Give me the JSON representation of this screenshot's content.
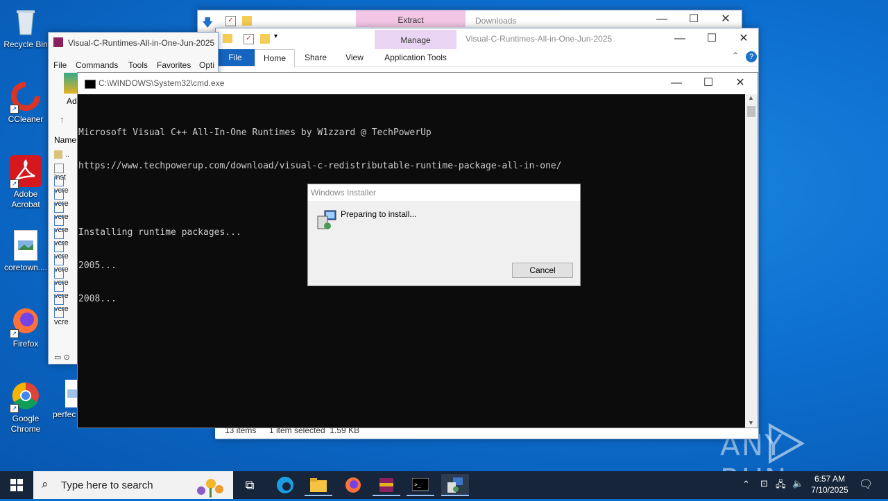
{
  "desktop": {
    "icons": [
      {
        "label": "Recycle Bin"
      },
      {
        "label": "CCleaner"
      },
      {
        "label": "Adobe Acrobat"
      },
      {
        "label": "coretown...."
      },
      {
        "label": "Firefox"
      },
      {
        "label": "Google Chrome"
      },
      {
        "label": "perfec"
      }
    ],
    "watermark": "ANY RUN"
  },
  "downloads_window": {
    "title": "Downloads",
    "context_tab": "Extract"
  },
  "explorer_window": {
    "title": "Visual-C-Runtimes-All-in-One-Jun-2025",
    "context_tab": "Manage",
    "tabs": [
      "File",
      "Home",
      "Share",
      "View",
      "Application Tools"
    ],
    "status_items": "13 items",
    "status_selected": "1 item selected  1.59 KB"
  },
  "winrar_window": {
    "title": "Visual-C-Runtimes-All-in-One-Jun-2025",
    "menu": [
      "File",
      "Commands",
      "Tools",
      "Favorites",
      "Opti"
    ],
    "toolbar_label": "Ad",
    "column_name": "Name",
    "rows": [
      "..",
      "inst",
      "vcre",
      "vcre",
      "vcre",
      "vcre",
      "vcre",
      "vcre",
      "vcre",
      "vcre",
      "vcre",
      "vcre",
      "vcre"
    ]
  },
  "cmd_window": {
    "title": "C:\\WINDOWS\\System32\\cmd.exe",
    "lines": [
      "Microsoft Visual C++ All-In-One Runtimes by W1zzard @ TechPowerUp",
      "https://www.techpowerup.com/download/visual-c-redistributable-runtime-package-all-in-one/",
      "",
      "Installing runtime packages...",
      "2005...",
      "2008..."
    ]
  },
  "installer_dialog": {
    "title": "Windows Installer",
    "message": "Preparing to install...",
    "cancel_label": "Cancel"
  },
  "taskbar": {
    "search_placeholder": "Type here to search",
    "time": "6:57 AM",
    "date": "7/10/2025"
  }
}
